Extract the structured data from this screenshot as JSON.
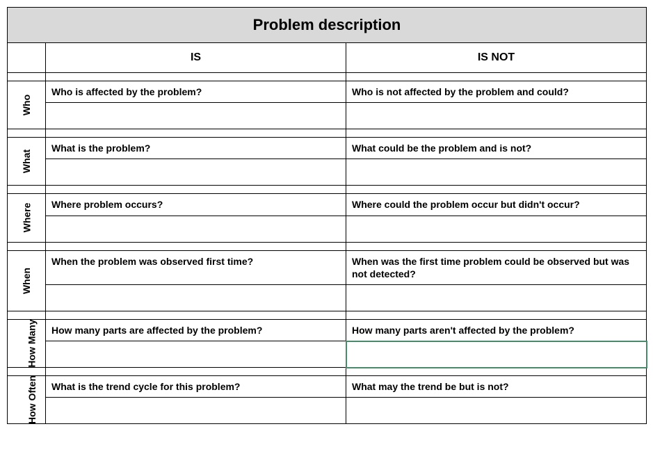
{
  "title": "Problem description",
  "headers": {
    "is": "IS",
    "isnot": "IS NOT"
  },
  "rows": [
    {
      "label": "Who",
      "is_q": "Who is affected by the problem?",
      "isnot_q": "Who is not affected by the problem and could?"
    },
    {
      "label": "What",
      "is_q": "What is the problem?",
      "isnot_q": "What could be the problem and is not?"
    },
    {
      "label": "Where",
      "is_q": "Where problem occurs?",
      "isnot_q": "Where could the problem occur but didn't occur?"
    },
    {
      "label": "When",
      "is_q": "When the problem was observed first time?",
      "isnot_q": "When was the first time problem could be observed but was not detected?"
    },
    {
      "label": "How Many",
      "is_q": "How many parts are affected by the problem?",
      "isnot_q": "How many parts aren't affected by the problem?",
      "isnot_answer_selected": true
    },
    {
      "label": "How Often",
      "is_q": "What is the trend cycle for this problem?",
      "isnot_q": "What may the trend be but is not?"
    }
  ]
}
